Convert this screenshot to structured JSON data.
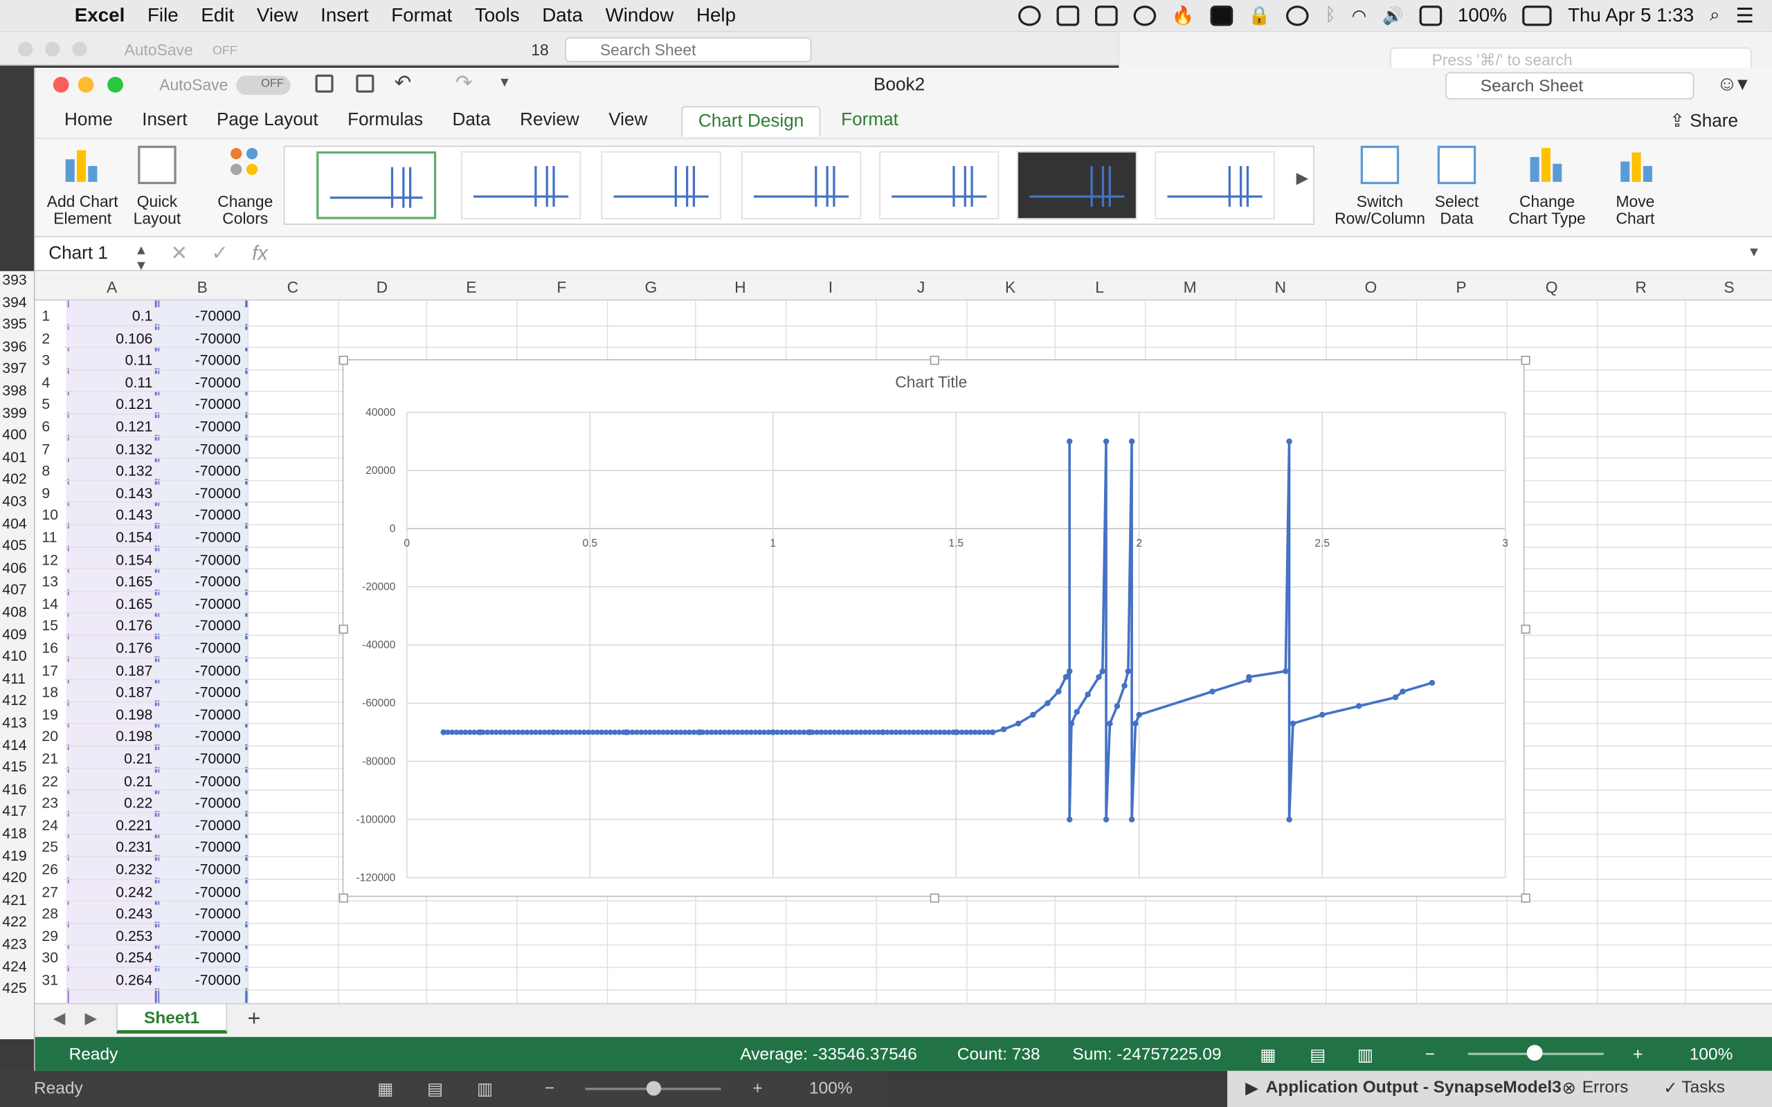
{
  "menubar": {
    "app": "Excel",
    "items": [
      "File",
      "Edit",
      "View",
      "Insert",
      "Format",
      "Tools",
      "Data",
      "Window",
      "Help"
    ],
    "battery": "100%",
    "datetime": "Thu Apr 5  1:33"
  },
  "bg_window": {
    "autosave": "AutoSave",
    "toggle": "OFF",
    "count": "18",
    "search_placeholder": "Search Sheet",
    "spotlight_placeholder": "Press '⌘/' to search"
  },
  "window": {
    "title": "Book2",
    "autosave": "AutoSave",
    "toggle": "OFF",
    "search_placeholder": "Search Sheet"
  },
  "tabs": [
    "Home",
    "Insert",
    "Page Layout",
    "Formulas",
    "Data",
    "Review",
    "View",
    "Chart Design",
    "Format"
  ],
  "active_tab": "Chart Design",
  "share": "Share",
  "ribbon": {
    "add_chart_element": [
      "Add Chart",
      "Element"
    ],
    "quick_layout": [
      "Quick",
      "Layout"
    ],
    "change_colors": [
      "Change",
      "Colors"
    ],
    "switch_row_col": [
      "Switch",
      "Row/Column"
    ],
    "select_data": [
      "Select",
      "Data"
    ],
    "change_chart_type": [
      "Change",
      "Chart Type"
    ],
    "move_chart": [
      "Move",
      "Chart"
    ]
  },
  "formula_bar": {
    "name_box": "Chart 1",
    "fx": "fx"
  },
  "columns": [
    "A",
    "B",
    "C",
    "D",
    "E",
    "F",
    "G",
    "H",
    "I",
    "J",
    "K",
    "L",
    "M",
    "N",
    "O",
    "P",
    "Q",
    "R",
    "S"
  ],
  "rows": [
    {
      "n": "1",
      "a": "0.1",
      "b": "-70000"
    },
    {
      "n": "2",
      "a": "0.106",
      "b": "-70000"
    },
    {
      "n": "3",
      "a": "0.11",
      "b": "-70000"
    },
    {
      "n": "4",
      "a": "0.11",
      "b": "-70000"
    },
    {
      "n": "5",
      "a": "0.121",
      "b": "-70000"
    },
    {
      "n": "6",
      "a": "0.121",
      "b": "-70000"
    },
    {
      "n": "7",
      "a": "0.132",
      "b": "-70000"
    },
    {
      "n": "8",
      "a": "0.132",
      "b": "-70000"
    },
    {
      "n": "9",
      "a": "0.143",
      "b": "-70000"
    },
    {
      "n": "10",
      "a": "0.143",
      "b": "-70000"
    },
    {
      "n": "11",
      "a": "0.154",
      "b": "-70000"
    },
    {
      "n": "12",
      "a": "0.154",
      "b": "-70000"
    },
    {
      "n": "13",
      "a": "0.165",
      "b": "-70000"
    },
    {
      "n": "14",
      "a": "0.165",
      "b": "-70000"
    },
    {
      "n": "15",
      "a": "0.176",
      "b": "-70000"
    },
    {
      "n": "16",
      "a": "0.176",
      "b": "-70000"
    },
    {
      "n": "17",
      "a": "0.187",
      "b": "-70000"
    },
    {
      "n": "18",
      "a": "0.187",
      "b": "-70000"
    },
    {
      "n": "19",
      "a": "0.198",
      "b": "-70000"
    },
    {
      "n": "20",
      "a": "0.198",
      "b": "-70000"
    },
    {
      "n": "21",
      "a": "0.21",
      "b": "-70000"
    },
    {
      "n": "22",
      "a": "0.21",
      "b": "-70000"
    },
    {
      "n": "23",
      "a": "0.22",
      "b": "-70000"
    },
    {
      "n": "24",
      "a": "0.221",
      "b": "-70000"
    },
    {
      "n": "25",
      "a": "0.231",
      "b": "-70000"
    },
    {
      "n": "26",
      "a": "0.232",
      "b": "-70000"
    },
    {
      "n": "27",
      "a": "0.242",
      "b": "-70000"
    },
    {
      "n": "28",
      "a": "0.243",
      "b": "-70000"
    },
    {
      "n": "29",
      "a": "0.253",
      "b": "-70000"
    },
    {
      "n": "30",
      "a": "0.254",
      "b": "-70000"
    },
    {
      "n": "31",
      "a": "0.264",
      "b": "-70000"
    }
  ],
  "gutter_rows": [
    "393",
    "394",
    "395",
    "396",
    "397",
    "398",
    "399",
    "400",
    "401",
    "402",
    "403",
    "404",
    "405",
    "406",
    "407",
    "408",
    "409",
    "410",
    "411",
    "412",
    "413",
    "414",
    "415",
    "416",
    "417",
    "418",
    "419",
    "420",
    "421",
    "422",
    "423",
    "424",
    "425"
  ],
  "sheet_tab": "Sheet1",
  "status": {
    "ready": "Ready",
    "average": "Average: -33546.37546",
    "count": "Count: 738",
    "sum": "Sum: -24757225.09",
    "zoom": "100%"
  },
  "bg_status": {
    "ready": "Ready",
    "zoom": "100%"
  },
  "app_output": {
    "label": "Application Output - SynapseModel3",
    "errors": "Errors",
    "tasks": "Tasks"
  },
  "chart_data": {
    "type": "scatter",
    "title": "Chart Title",
    "xlim": [
      0,
      3
    ],
    "ylim": [
      -120000,
      40000
    ],
    "x_ticks": [
      0,
      0.5,
      1,
      1.5,
      2,
      2.5,
      3
    ],
    "y_ticks": [
      40000,
      20000,
      0,
      -20000,
      -40000,
      -60000,
      -80000,
      -100000,
      -120000
    ],
    "series": [
      {
        "color": "#4472c4",
        "points": [
          [
            0.1,
            -70000
          ],
          [
            0.2,
            -70000
          ],
          [
            0.4,
            -70000
          ],
          [
            0.6,
            -70000
          ],
          [
            0.8,
            -70000
          ],
          [
            1.0,
            -70000
          ],
          [
            1.1,
            -70000
          ],
          [
            1.3,
            -70000
          ],
          [
            1.5,
            -70000
          ],
          [
            1.6,
            -70000
          ],
          [
            1.63,
            -69000
          ],
          [
            1.67,
            -67000
          ],
          [
            1.71,
            -64000
          ],
          [
            1.75,
            -60000
          ],
          [
            1.78,
            -56000
          ],
          [
            1.8,
            -51000
          ],
          [
            1.81,
            -49000
          ],
          [
            1.81,
            30000
          ],
          [
            1.81,
            -100000
          ],
          [
            1.815,
            -67000
          ],
          [
            1.83,
            -63000
          ],
          [
            1.86,
            -57000
          ],
          [
            1.89,
            -51000
          ],
          [
            1.9,
            -49000
          ],
          [
            1.91,
            30000
          ],
          [
            1.91,
            -100000
          ],
          [
            1.92,
            -67000
          ],
          [
            1.94,
            -61000
          ],
          [
            1.96,
            -54000
          ],
          [
            1.97,
            -49000
          ],
          [
            1.98,
            30000
          ],
          [
            1.98,
            -100000
          ],
          [
            1.99,
            -67000
          ],
          [
            2.0,
            -64000
          ],
          [
            2.2,
            -56000
          ],
          [
            2.3,
            -52000
          ],
          [
            2.3,
            -51000
          ],
          [
            2.4,
            -49000
          ],
          [
            2.41,
            30000
          ],
          [
            2.41,
            -100000
          ],
          [
            2.42,
            -67000
          ],
          [
            2.5,
            -64000
          ],
          [
            2.6,
            -61000
          ],
          [
            2.7,
            -58000
          ],
          [
            2.72,
            -56000
          ],
          [
            2.8,
            -53000
          ]
        ]
      }
    ]
  }
}
